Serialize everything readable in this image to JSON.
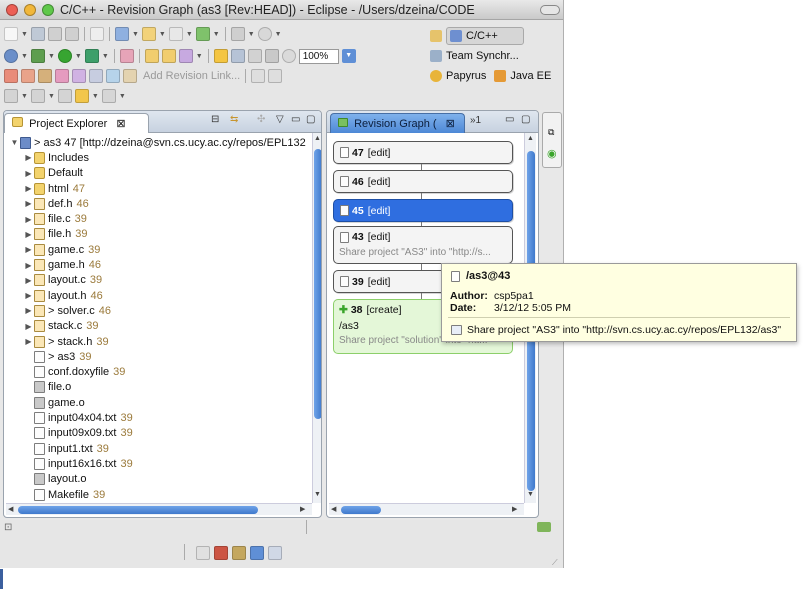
{
  "window": {
    "title": "C/C++ - Revision Graph (as3 [Rev:HEAD]) - Eclipse - /Users/dzeina/CODE"
  },
  "toolbar": {
    "add_revision_link": "Add Revision Link...",
    "zoom": "100%"
  },
  "perspectives": [
    {
      "label": "C/C++",
      "icon": "cpp-perspective-icon",
      "selected": true
    },
    {
      "label": "Team Synchr...",
      "icon": "sync-perspective-icon",
      "selected": false
    },
    {
      "label": "Papyrus",
      "icon": "papyrus-perspective-icon",
      "selected": false
    },
    {
      "label": "Java EE",
      "icon": "javaee-perspective-icon",
      "selected": false
    }
  ],
  "project_explorer": {
    "tab_label": "Project Explorer",
    "root": {
      "label": "> as3 47 [http://dzeina@svn.cs.ucy.ac.cy/repos/EPL132"
    },
    "items": [
      {
        "name": "Includes",
        "rev": "",
        "kind": "includes",
        "twisty": "▶",
        "indent": 1
      },
      {
        "name": "Default",
        "rev": "",
        "kind": "folder",
        "twisty": "▶",
        "indent": 1
      },
      {
        "name": "html",
        "rev": "47",
        "kind": "folder",
        "twisty": "▶",
        "indent": 1
      },
      {
        "name": "def.h",
        "rev": "46",
        "kind": "header",
        "twisty": "▶",
        "indent": 1
      },
      {
        "name": "file.c",
        "rev": "39",
        "kind": "source",
        "twisty": "▶",
        "indent": 1
      },
      {
        "name": "file.h",
        "rev": "39",
        "kind": "header",
        "twisty": "▶",
        "indent": 1
      },
      {
        "name": "game.c",
        "rev": "39",
        "kind": "source",
        "twisty": "▶",
        "indent": 1
      },
      {
        "name": "game.h",
        "rev": "46",
        "kind": "header",
        "twisty": "▶",
        "indent": 1
      },
      {
        "name": "layout.c",
        "rev": "39",
        "kind": "source",
        "twisty": "▶",
        "indent": 1
      },
      {
        "name": "layout.h",
        "rev": "46",
        "kind": "header",
        "twisty": "▶",
        "indent": 1
      },
      {
        "name": "> solver.c",
        "rev": "46",
        "kind": "source",
        "twisty": "▶",
        "indent": 1
      },
      {
        "name": "stack.c",
        "rev": "39",
        "kind": "source",
        "twisty": "▶",
        "indent": 1
      },
      {
        "name": "> stack.h",
        "rev": "39",
        "kind": "header",
        "twisty": "▶",
        "indent": 1
      },
      {
        "name": "> as3",
        "rev": "39",
        "kind": "file",
        "twisty": "",
        "indent": 1
      },
      {
        "name": "conf.doxyfile",
        "rev": "39",
        "kind": "file",
        "twisty": "",
        "indent": 1
      },
      {
        "name": "file.o",
        "rev": "",
        "kind": "object",
        "twisty": "",
        "indent": 1
      },
      {
        "name": "game.o",
        "rev": "",
        "kind": "object",
        "twisty": "",
        "indent": 1
      },
      {
        "name": "input04x04.txt",
        "rev": "39",
        "kind": "file",
        "twisty": "",
        "indent": 1
      },
      {
        "name": "input09x09.txt",
        "rev": "39",
        "kind": "file",
        "twisty": "",
        "indent": 1
      },
      {
        "name": "input1.txt",
        "rev": "39",
        "kind": "file",
        "twisty": "",
        "indent": 1
      },
      {
        "name": "input16x16.txt",
        "rev": "39",
        "kind": "file",
        "twisty": "",
        "indent": 1
      },
      {
        "name": "layout.o",
        "rev": "",
        "kind": "object",
        "twisty": "",
        "indent": 1
      },
      {
        "name": "Makefile",
        "rev": "39",
        "kind": "file",
        "twisty": "",
        "indent": 1
      }
    ]
  },
  "revision_graph": {
    "tab_label": "Revision Graph (",
    "overflow_label": "»1",
    "nodes": [
      {
        "rev": "47",
        "action": "[edit]",
        "selected": false
      },
      {
        "rev": "46",
        "action": "[edit]",
        "selected": false
      },
      {
        "rev": "45",
        "action": "[edit]",
        "selected": true
      },
      {
        "rev": "43",
        "action": "[edit]",
        "selected": false,
        "message": "Share project \"AS3\" into \"http://s..."
      },
      {
        "rev": "39",
        "action": "[edit]",
        "selected": false
      },
      {
        "rev": "38",
        "action": "[create]",
        "selected": false,
        "path": "/as3",
        "message": "Share project \"solution\" into \"htt..."
      }
    ]
  },
  "tooltip": {
    "title": "/as3@43",
    "author_label": "Author:",
    "author": "csp5pa1",
    "date_label": "Date:",
    "date": "3/12/12 5:05 PM",
    "message": "Share project \"AS3\" into \"http://svn.cs.ucy.ac.cy/repos/EPL132/as3\""
  }
}
